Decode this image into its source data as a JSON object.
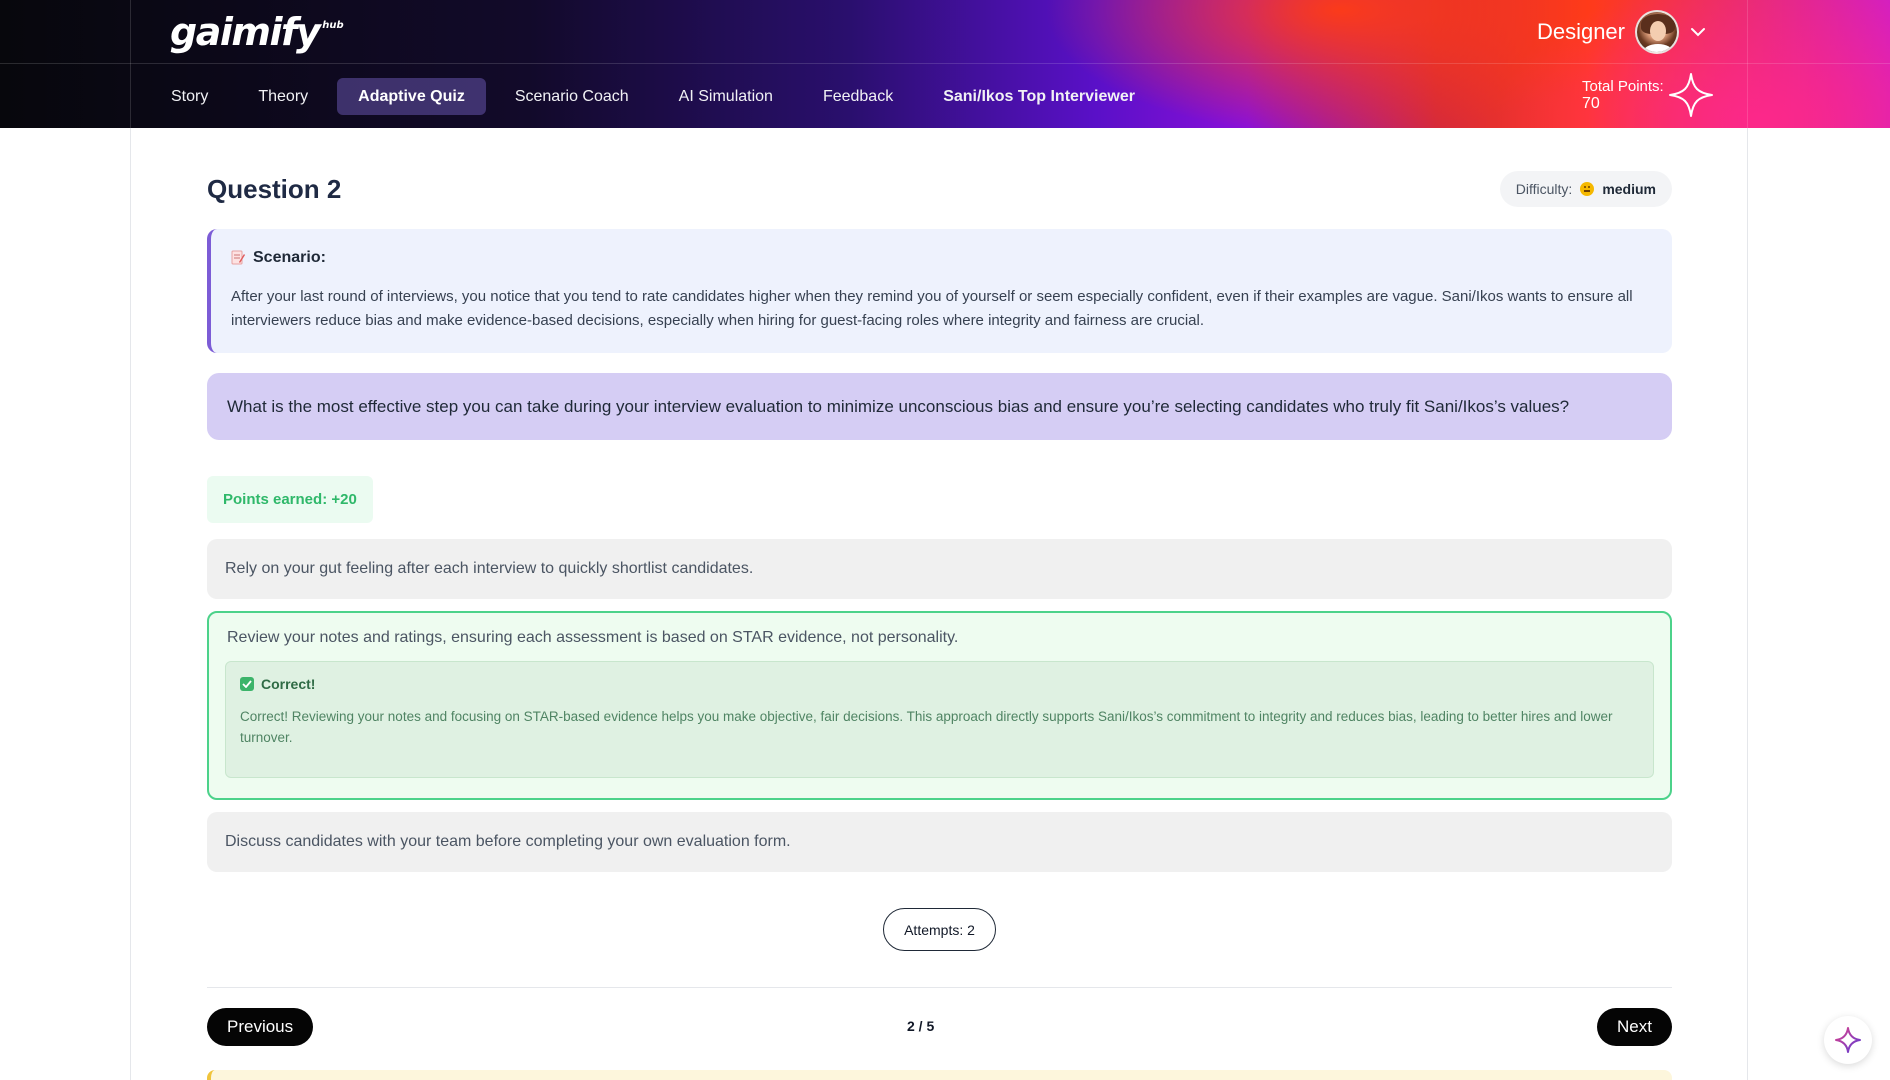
{
  "app": {
    "logo_text": "gaimify",
    "logo_sub": "hub"
  },
  "user": {
    "role_label": "Designer"
  },
  "nav": {
    "tabs": [
      {
        "label": "Story"
      },
      {
        "label": "Theory"
      },
      {
        "label": "Adaptive Quiz",
        "active": true
      },
      {
        "label": "Scenario Coach"
      },
      {
        "label": "AI Simulation"
      },
      {
        "label": "Feedback"
      },
      {
        "label": "Sani/Ikos Top Interviewer"
      }
    ]
  },
  "points": {
    "label": "Total Points:",
    "value": "70"
  },
  "question": {
    "title": "Question 2",
    "difficulty_label": "Difficulty:",
    "difficulty_value": "medium",
    "scenario_label": "Scenario:",
    "scenario_text": "After your last round of interviews, you notice that you tend to rate candidates higher when they remind you of yourself or seem especially confident, even if their examples are vague. Sani/Ikos wants to ensure all interviewers reduce bias and make evidence-based decisions, especially when hiring for guest-facing roles where integrity and fairness are crucial.",
    "prompt": "What is the most effective step you can take during your interview evaluation to minimize unconscious bias and ensure you’re selecting candidates who truly fit Sani/Ikos’s values?",
    "points_earned": "Points earned: +20",
    "options": [
      {
        "text": "Rely on your gut feeling after each interview to quickly shortlist candidates."
      },
      {
        "text": "Review your notes and ratings, ensuring each assessment is based on STAR evidence, not personality.",
        "correct": true
      },
      {
        "text": "Discuss candidates with your team before completing your own evaluation form."
      }
    ],
    "feedback_title": "Correct!",
    "feedback_text": "Correct! Reviewing your notes and focusing on STAR-based evidence helps you make objective, fair decisions. This approach directly supports Sani/Ikos’s commitment to integrity and reduces bias, leading to better hires and lower turnover.",
    "attempts": "Attempts: 2"
  },
  "pagination": {
    "previous_label": "Previous",
    "next_label": "Next",
    "indicator": "2 / 5"
  },
  "colors": {
    "accent_purple": "#7c5cd6",
    "question_bg": "#d5cdf4",
    "correct_green": "#4cd28a",
    "button_black": "#050505"
  },
  "icons": {
    "user_menu": "chevron-down-icon",
    "points": "sparkle-icon",
    "scenario": "memo-icon",
    "difficulty": "neutral-face-icon",
    "feedback": "check-box-icon",
    "assistant": "sparkle-icon"
  }
}
